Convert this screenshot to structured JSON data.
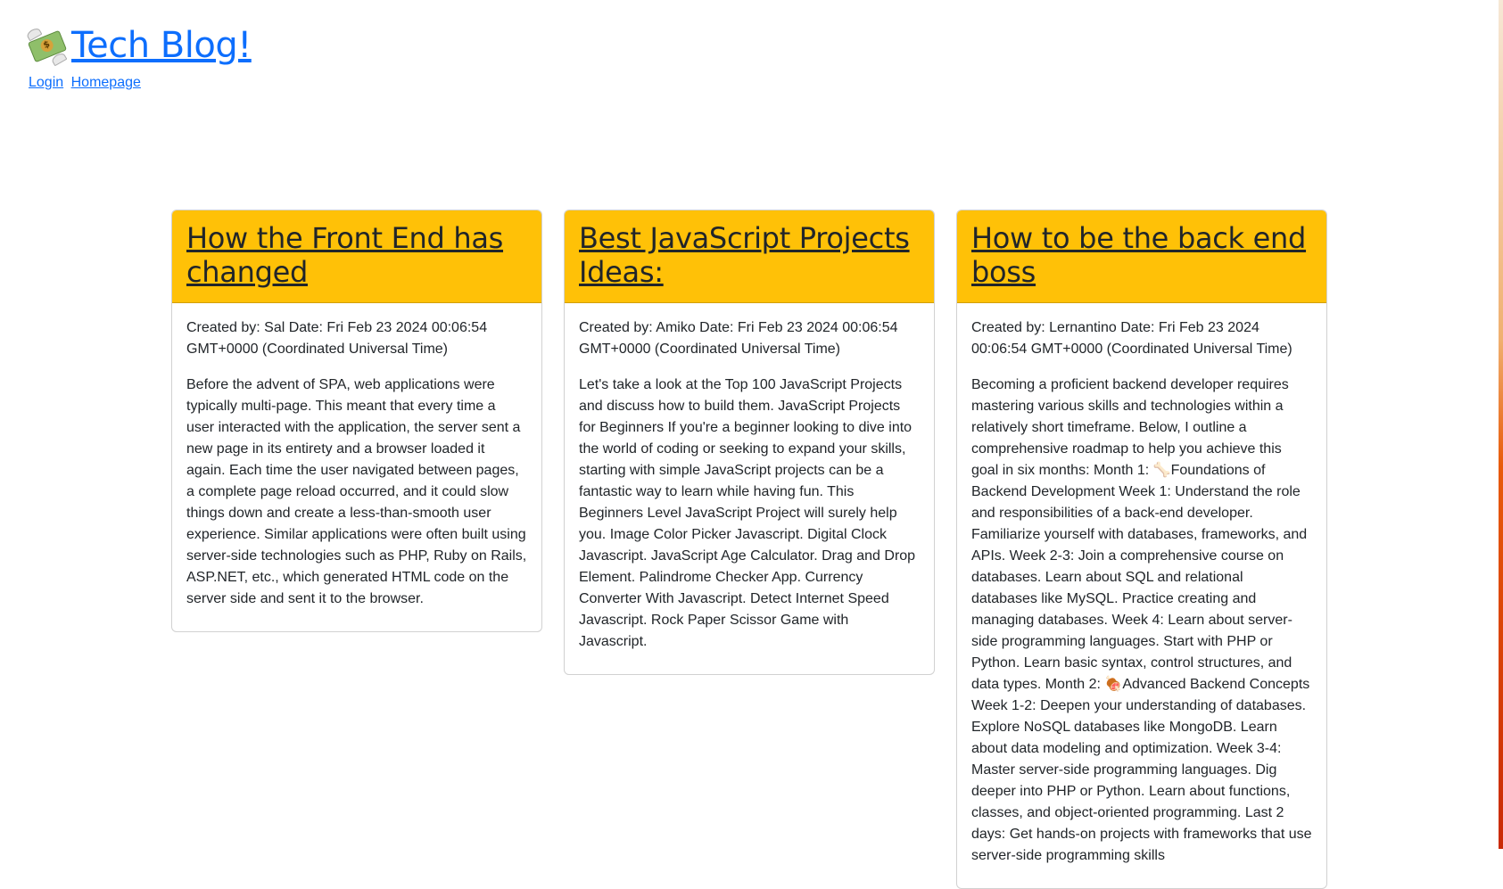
{
  "header": {
    "site_title": "Tech Blog!",
    "logo_icon": "money-with-wings-icon",
    "nav": [
      {
        "label": "Login"
      },
      {
        "label": "Homepage"
      }
    ]
  },
  "posts": [
    {
      "title": "How the Front End has changed",
      "meta": "Created by: Sal Date: Fri Feb 23 2024 00:06:54 GMT+0000 (Coordinated Universal Time)",
      "content": "Before the advent of SPA, web applications were typically multi-page. This meant that every time a user interacted with the application, the server sent a new page in its entirety and a browser loaded it again. Each time the user navigated between pages, a complete page reload occurred, and it could slow things down and create a less-than-smooth user experience. Similar applications were often built using server-side technologies such as PHP, Ruby on Rails, ASP.NET, etc., which generated HTML code on the server side and sent it to the browser."
    },
    {
      "title": "Best JavaScript Projects Ideas:",
      "meta": "Created by: Amiko Date: Fri Feb 23 2024 00:06:54 GMT+0000 (Coordinated Universal Time)",
      "content": "Let's take a look at the Top 100 JavaScript Projects and discuss how to build them. JavaScript Projects for Beginners If you're a beginner looking to dive into the world of coding or seeking to expand your skills, starting with simple JavaScript projects can be a fantastic way to learn while having fun. This Beginners Level JavaScript Project will surely help you. Image Color Picker Javascript. Digital Clock Javascript. JavaScript Age Calculator. Drag and Drop Element. Palindrome Checker App. Currency Converter With Javascript. Detect Internet Speed Javascript. Rock Paper Scissor Game with Javascript."
    },
    {
      "title": "How to be the back end boss",
      "meta": "Created by: Lernantino Date: Fri Feb 23 2024 00:06:54 GMT+0000 (Coordinated Universal Time)",
      "content": "Becoming a proficient backend developer requires mastering various skills and technologies within a relatively short timeframe. Below, I outline a comprehensive roadmap to help you achieve this goal in six months: Month 1: 🦴Foundations of Backend Development Week 1: Understand the role and responsibilities of a back-end developer. Familiarize yourself with databases, frameworks, and APIs. Week 2-3: Join a comprehensive course on databases. Learn about SQL and relational databases like MySQL. Practice creating and managing databases. Week 4: Learn about server-side programming languages. Start with PHP or Python. Learn basic syntax, control structures, and data types. Month 2: 🍖Advanced Backend Concepts Week 1-2: Deepen your understanding of databases. Explore NoSQL databases like MongoDB. Learn about data modeling and optimization. Week 3-4: Master server-side programming languages. Dig deeper into PHP or Python. Learn about functions, classes, and object-oriented programming. Last 2 days: Get hands-on projects with frameworks that use server-side programming skills"
    }
  ]
}
